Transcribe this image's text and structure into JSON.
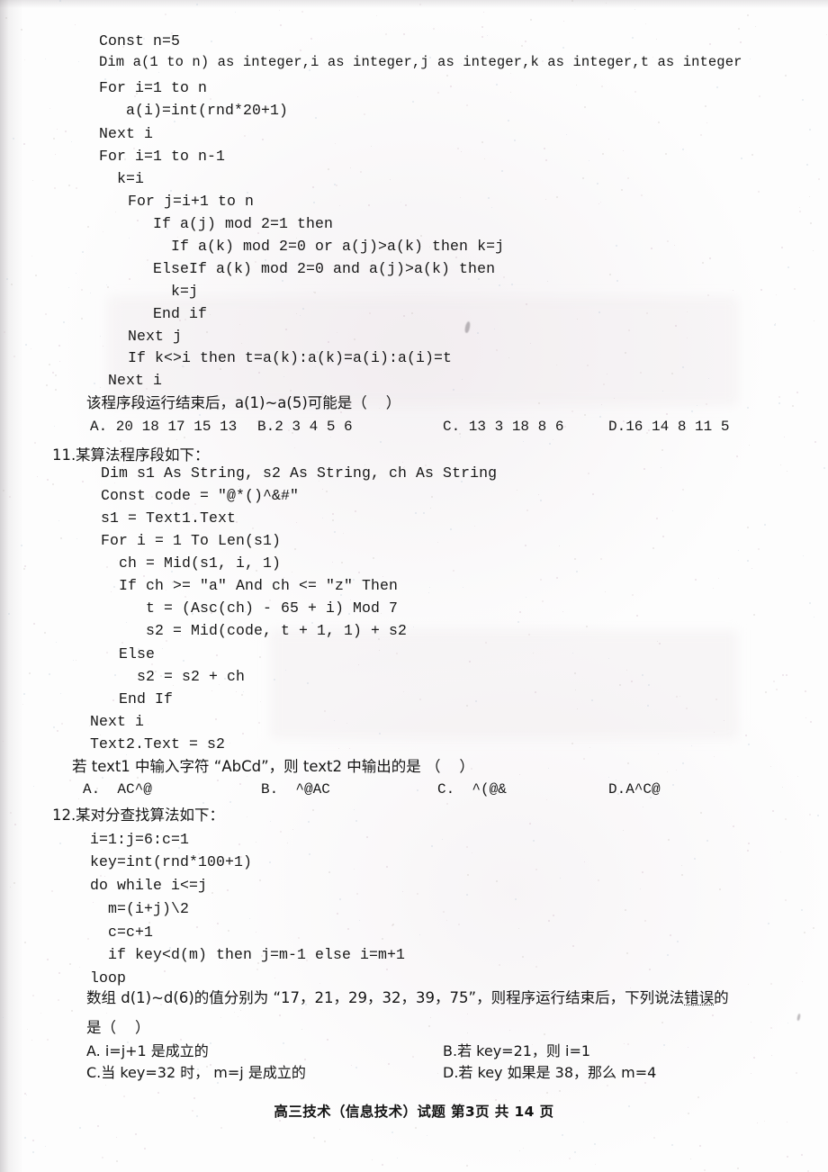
{
  "document": {
    "type": "exam-paper-scan",
    "footer": "高三技术（信息技术）试题  第3页  共 14 页"
  },
  "question_10": {
    "code_lines": [
      "Const n=5",
      "Dim a(1 to n) as integer,i as integer,j as integer,k as integer,t as integer",
      "For i=1 to n",
      "   a(i)=int(rnd*20+1)",
      "Next i",
      "For i=1 to n-1",
      "  k=i",
      "  For j=i+1 to n",
      "   If a(j) mod 2=1 then",
      "     If a(k) mod 2=0 or a(j)>a(k) then k=j",
      "   ElseIf a(k) mod 2=0 and a(j)>a(k) then",
      "     k=j",
      "   End if",
      "  Next j",
      "  If k<>i then t=a(k):a(k)=a(i):a(i)=t",
      " Next i"
    ],
    "prompt": "该程序段运行结束后，a(1)~a(5)可能是（    ）",
    "options": [
      "A. 20 18 17 15 13",
      "B.2 3 4 5 6",
      "C. 13 3 18 8 6",
      "D.16 14 8 11 5"
    ]
  },
  "question_11": {
    "number": "11.",
    "title": "某算法程序段如下：",
    "code_lines": [
      "Dim s1 As String, s2 As String, ch As String",
      "Const code = \"@*()^&#\"",
      "s1 = Text1.Text",
      "For i = 1 To Len(s1)",
      "  ch = Mid(s1, i, 1)",
      "  If ch >= \"a\" And ch <= \"z\" Then",
      "     t = (Asc(ch) - 65 + i) Mod 7",
      "     s2 = Mid(code, t + 1, 1) + s2",
      "  Else",
      "    s2 = s2 + ch",
      "  End If",
      "Next i",
      "Text2.Text = s2"
    ],
    "prompt": "若 text1 中输入字符 “AbCd”，则 text2 中输出的是 （    ）",
    "options": [
      "A.  AC^@",
      "B.  ^@AC",
      "C.  ^(@&",
      "D.A^C@"
    ]
  },
  "question_12": {
    "number": "12.",
    "title": "某对分查找算法如下：",
    "code_lines": [
      "i=1:j=6:c=1",
      "key=int(rnd*100+1)",
      "do while i<=j",
      "  m=(i+j)\\2",
      "  c=c+1",
      "  if key<d(m) then j=m-1 else i=m+1",
      "loop"
    ],
    "prompt_line1_a": "数组 d(1)~d(6)的值分别为 “17，21，29，32，39，75”，则程序运行结束后，下列说法",
    "prompt_line1_emph": "错误",
    "prompt_line1_b": "的",
    "prompt_line2": "是（    ）",
    "options": [
      "A. i=j+1 是成立的",
      "B.若 key=21，则 i=1",
      "C.当 key=32 时， m=j 是成立的",
      "D.若 key 如果是 38，那么 m=4"
    ]
  }
}
